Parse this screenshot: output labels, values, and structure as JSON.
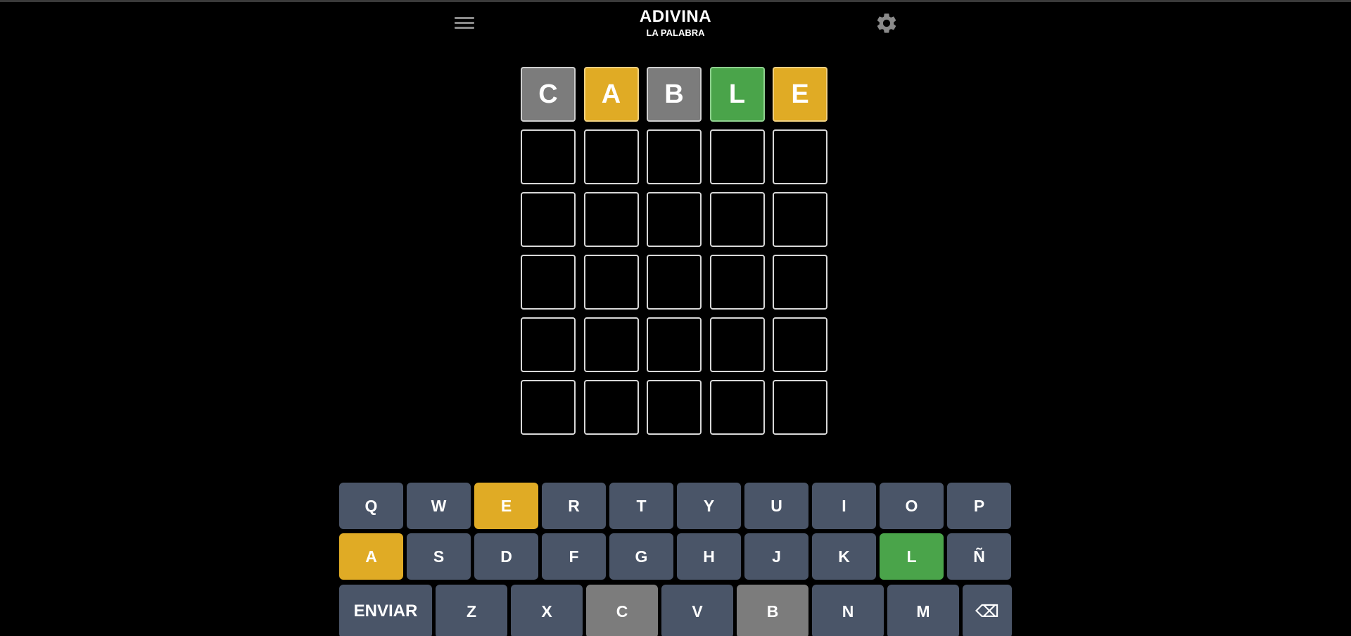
{
  "header": {
    "title": "ADIVINA",
    "subtitle": "LA PALABRA",
    "menu_icon": "hamburger-menu-icon",
    "settings_icon": "gear-icon"
  },
  "colors": {
    "absent": "#7c7c7c",
    "present": "#e0ab25",
    "correct": "#4aa44a",
    "key_default": "#4a5568",
    "background": "#000000"
  },
  "board": {
    "rows": [
      [
        {
          "letter": "C",
          "state": "absent"
        },
        {
          "letter": "A",
          "state": "present"
        },
        {
          "letter": "B",
          "state": "absent"
        },
        {
          "letter": "L",
          "state": "correct"
        },
        {
          "letter": "E",
          "state": "present"
        }
      ],
      [
        {
          "letter": "",
          "state": "empty"
        },
        {
          "letter": "",
          "state": "empty"
        },
        {
          "letter": "",
          "state": "empty"
        },
        {
          "letter": "",
          "state": "empty"
        },
        {
          "letter": "",
          "state": "empty"
        }
      ],
      [
        {
          "letter": "",
          "state": "empty"
        },
        {
          "letter": "",
          "state": "empty"
        },
        {
          "letter": "",
          "state": "empty"
        },
        {
          "letter": "",
          "state": "empty"
        },
        {
          "letter": "",
          "state": "empty"
        }
      ],
      [
        {
          "letter": "",
          "state": "empty"
        },
        {
          "letter": "",
          "state": "empty"
        },
        {
          "letter": "",
          "state": "empty"
        },
        {
          "letter": "",
          "state": "empty"
        },
        {
          "letter": "",
          "state": "empty"
        }
      ],
      [
        {
          "letter": "",
          "state": "empty"
        },
        {
          "letter": "",
          "state": "empty"
        },
        {
          "letter": "",
          "state": "empty"
        },
        {
          "letter": "",
          "state": "empty"
        },
        {
          "letter": "",
          "state": "empty"
        }
      ],
      [
        {
          "letter": "",
          "state": "empty"
        },
        {
          "letter": "",
          "state": "empty"
        },
        {
          "letter": "",
          "state": "empty"
        },
        {
          "letter": "",
          "state": "empty"
        },
        {
          "letter": "",
          "state": "empty"
        }
      ]
    ]
  },
  "keyboard": {
    "row1": [
      {
        "label": "Q",
        "state": "default"
      },
      {
        "label": "W",
        "state": "default"
      },
      {
        "label": "E",
        "state": "present"
      },
      {
        "label": "R",
        "state": "default"
      },
      {
        "label": "T",
        "state": "default"
      },
      {
        "label": "Y",
        "state": "default"
      },
      {
        "label": "U",
        "state": "default"
      },
      {
        "label": "I",
        "state": "default"
      },
      {
        "label": "O",
        "state": "default"
      },
      {
        "label": "P",
        "state": "default"
      }
    ],
    "row2": [
      {
        "label": "A",
        "state": "present"
      },
      {
        "label": "S",
        "state": "default"
      },
      {
        "label": "D",
        "state": "default"
      },
      {
        "label": "F",
        "state": "default"
      },
      {
        "label": "G",
        "state": "default"
      },
      {
        "label": "H",
        "state": "default"
      },
      {
        "label": "J",
        "state": "default"
      },
      {
        "label": "K",
        "state": "default"
      },
      {
        "label": "L",
        "state": "correct"
      },
      {
        "label": "Ñ",
        "state": "default"
      }
    ],
    "row3": [
      {
        "label": "ENVIAR",
        "state": "default",
        "kind": "enter"
      },
      {
        "label": "Z",
        "state": "default"
      },
      {
        "label": "X",
        "state": "default"
      },
      {
        "label": "C",
        "state": "absent"
      },
      {
        "label": "V",
        "state": "default"
      },
      {
        "label": "B",
        "state": "absent"
      },
      {
        "label": "N",
        "state": "default"
      },
      {
        "label": "M",
        "state": "default"
      },
      {
        "label": "⌫",
        "state": "default",
        "kind": "backspace"
      }
    ]
  }
}
